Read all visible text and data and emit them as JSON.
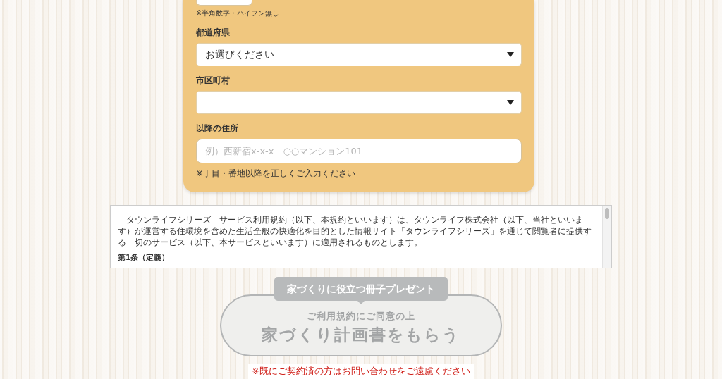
{
  "form": {
    "partial_field_note": "※半角数字・ハイフン無し",
    "fields": [
      {
        "kind": "select",
        "label": "都道府県",
        "value": "お選びください"
      },
      {
        "kind": "select",
        "label": "市区町村"
      },
      {
        "kind": "input",
        "label": "以降の住所",
        "placeholder": "例）西新宿x-x-x　○○マンション101",
        "note": "※丁目・番地以降を正しくご入力ください"
      }
    ]
  },
  "terms": {
    "paragraphs": [
      "「タウンライフシリーズ」サービス利用規約（以下、本規約といいます）は、タウンライフ株式会社（以下、当社といいます）が運営する住環境を含めた生活全般の快適化を目的とした情報サイト「タウンライフシリーズ」を通じて閲覧者に提供する一切のサービス（以下、本サービスといいます）に適用されるものとします。"
    ],
    "heading": "第1条（定義）"
  },
  "submit": {
    "badge": "家づくりに役立つ冊子プレゼント",
    "subtitle": "ご利用規約にご同意の上",
    "label": "家づくり計画書をもらう",
    "disabled": true
  },
  "notice": "※既にご契約済の方はお問い合わせをご遠慮ください"
}
